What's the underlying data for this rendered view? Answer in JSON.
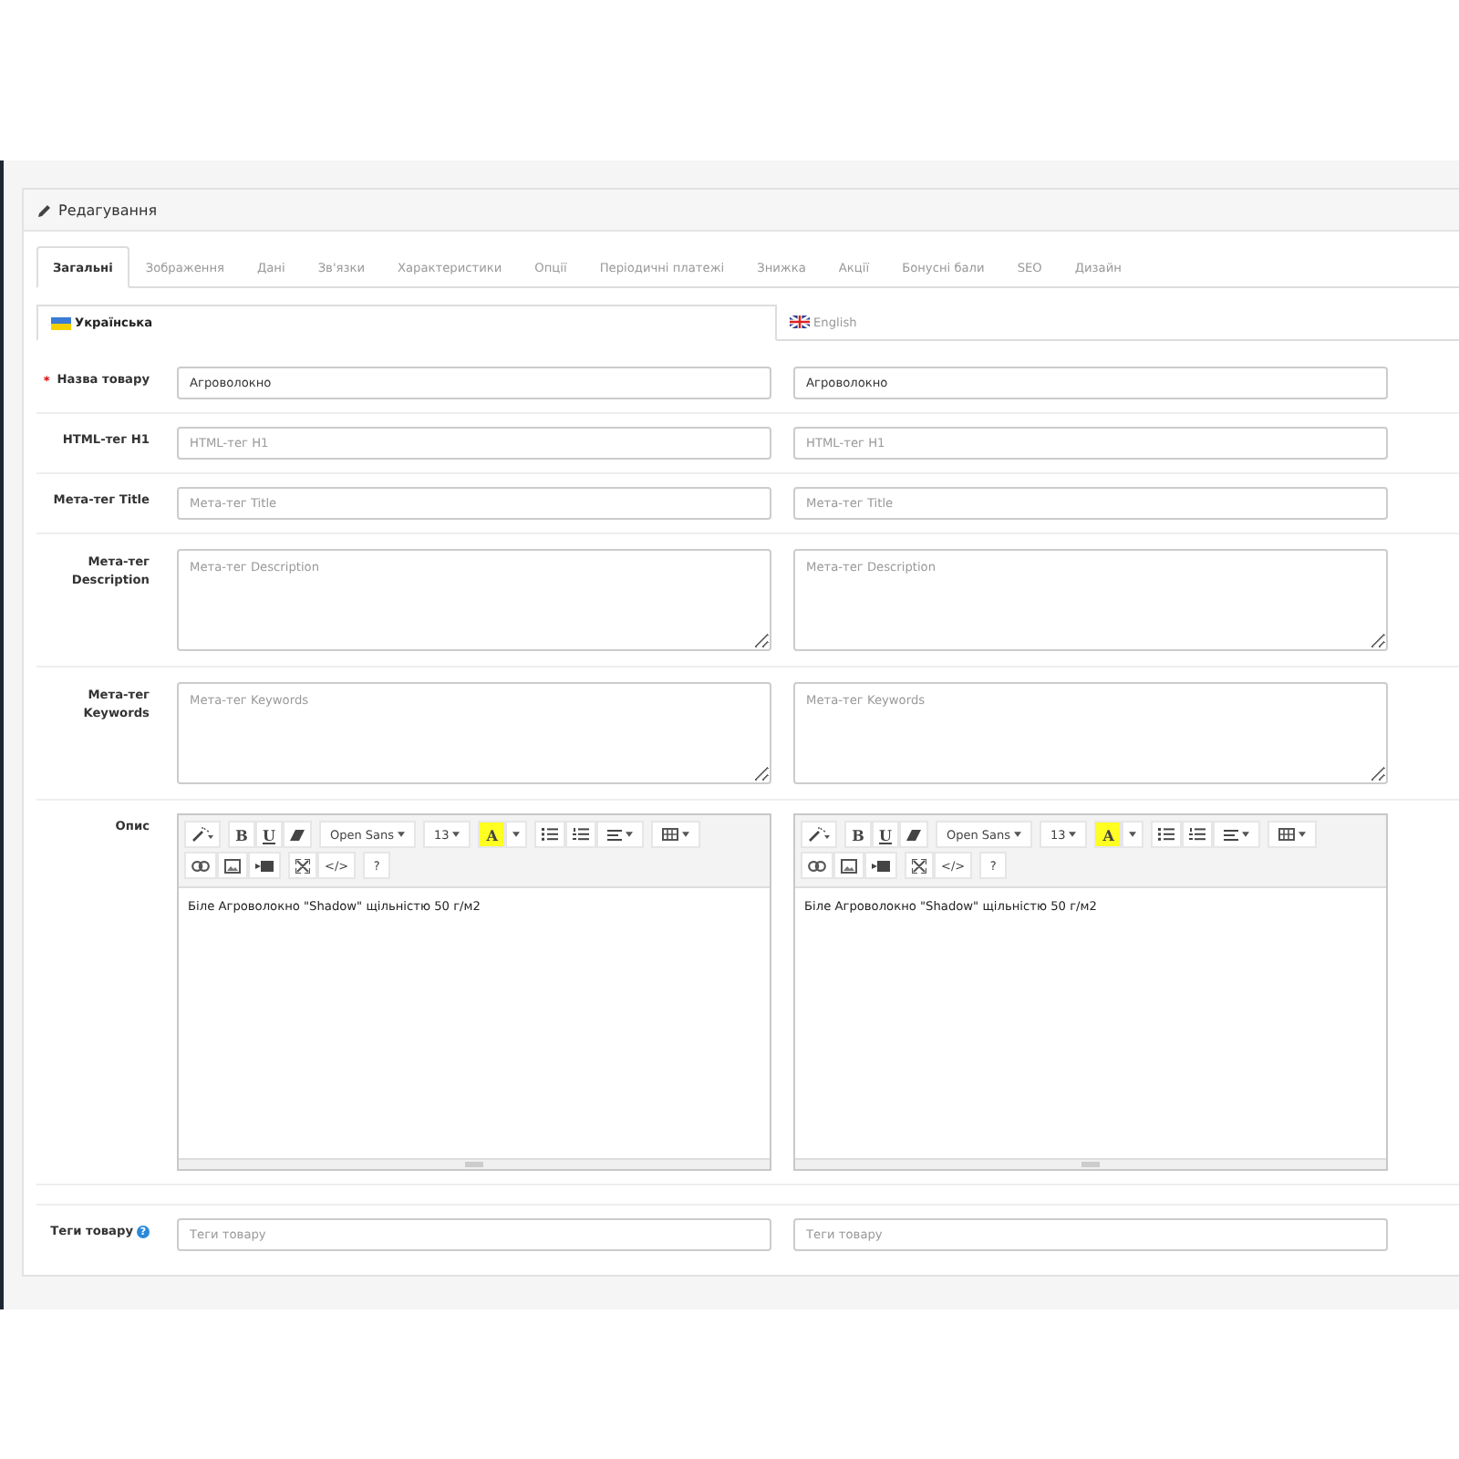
{
  "panel": {
    "title": "Редагування"
  },
  "tabs": [
    {
      "label": "Загальні",
      "selected": true
    },
    {
      "label": "Зображення",
      "selected": false
    },
    {
      "label": "Дані",
      "selected": false
    },
    {
      "label": "Зв'язки",
      "selected": false
    },
    {
      "label": "Характеристики",
      "selected": false
    },
    {
      "label": "Опції",
      "selected": false
    },
    {
      "label": "Періодичні платежі",
      "selected": false
    },
    {
      "label": "Знижка",
      "selected": false
    },
    {
      "label": "Акції",
      "selected": false
    },
    {
      "label": "Бонусні бали",
      "selected": false
    },
    {
      "label": "SEO",
      "selected": false
    },
    {
      "label": "Дизайн",
      "selected": false
    }
  ],
  "language_tabs": [
    {
      "label": "Українська",
      "selected": true,
      "kind": "ukraine"
    },
    {
      "label": "English",
      "selected": false,
      "kind": "britain"
    }
  ],
  "fields": [
    {
      "kind": "input",
      "label": "Назва товару",
      "required_mark": "*",
      "inputs": [
        {
          "value": "Агроволокно"
        },
        {
          "value": "Агроволокно"
        }
      ]
    },
    {
      "kind": "input",
      "label": "HTML-тег H1",
      "inputs": [
        {
          "placeholder": "HTML-тег H1"
        },
        {
          "placeholder": "HTML-тег H1"
        }
      ]
    },
    {
      "kind": "input",
      "label": "Мета-тег Title",
      "inputs": [
        {
          "placeholder": "Мета-тег Title"
        },
        {
          "placeholder": "Мета-тег Title"
        }
      ]
    },
    {
      "kind": "textarea",
      "label": "Мета-тег Description",
      "inputs": [
        {
          "placeholder": "Мета-тег Description"
        },
        {
          "placeholder": "Мета-тег Description"
        }
      ]
    },
    {
      "kind": "textarea",
      "label": "Мета-тег Keywords",
      "inputs": [
        {
          "placeholder": "Мета-тег Keywords"
        },
        {
          "placeholder": "Мета-тег Keywords"
        }
      ]
    },
    {
      "kind": "editor",
      "label": "Опис",
      "editors": [
        {
          "content": "Біле Агроволокно \"Shadow\" щільністю 50 г/м2",
          "toolbar": [
            [
              [
                {
                  "kind": "wand"
                }
              ],
              [
                {
                  "kind": "bold",
                  "label": "B"
                },
                {
                  "kind": "underline",
                  "label": "U"
                },
                {
                  "kind": "eraser"
                }
              ],
              [
                {
                  "kind": "dropdown",
                  "label": "Open Sans"
                }
              ],
              [
                {
                  "kind": "dropdown",
                  "label": "13"
                }
              ],
              [
                {
                  "kind": "color",
                  "label": "A"
                },
                {
                  "kind": "caret"
                }
              ],
              [
                {
                  "kind": "ul"
                },
                {
                  "kind": "ol"
                },
                {
                  "kind": "align"
                }
              ],
              [
                {
                  "kind": "table"
                }
              ]
            ],
            [
              [
                {
                  "kind": "link"
                },
                {
                  "kind": "image"
                },
                {
                  "kind": "video"
                }
              ],
              [
                {
                  "kind": "fullscreen"
                },
                {
                  "kind": "text",
                  "label": "</>"
                }
              ],
              [
                {
                  "kind": "text",
                  "label": "?"
                }
              ]
            ]
          ]
        },
        {
          "content": "Біле Агроволокно \"Shadow\" щільністю 50 г/м2",
          "toolbar": [
            [
              [
                {
                  "kind": "wand"
                }
              ],
              [
                {
                  "kind": "bold",
                  "label": "B"
                },
                {
                  "kind": "underline",
                  "label": "U"
                },
                {
                  "kind": "eraser"
                }
              ],
              [
                {
                  "kind": "dropdown",
                  "label": "Open Sans"
                }
              ],
              [
                {
                  "kind": "dropdown",
                  "label": "13"
                }
              ],
              [
                {
                  "kind": "color",
                  "label": "A"
                },
                {
                  "kind": "caret"
                }
              ],
              [
                {
                  "kind": "ul"
                },
                {
                  "kind": "ol"
                },
                {
                  "kind": "align"
                }
              ],
              [
                {
                  "kind": "table"
                }
              ]
            ],
            [
              [
                {
                  "kind": "link"
                },
                {
                  "kind": "image"
                },
                {
                  "kind": "video"
                }
              ],
              [
                {
                  "kind": "fullscreen"
                },
                {
                  "kind": "text",
                  "label": "</>"
                }
              ],
              [
                {
                  "kind": "text",
                  "label": "?"
                }
              ]
            ]
          ]
        }
      ]
    },
    {
      "kind": "input",
      "label": "Теги товару",
      "help": "?",
      "inputs": [
        {
          "placeholder": "Теги товару"
        },
        {
          "placeholder": "Теги товару"
        }
      ]
    }
  ]
}
